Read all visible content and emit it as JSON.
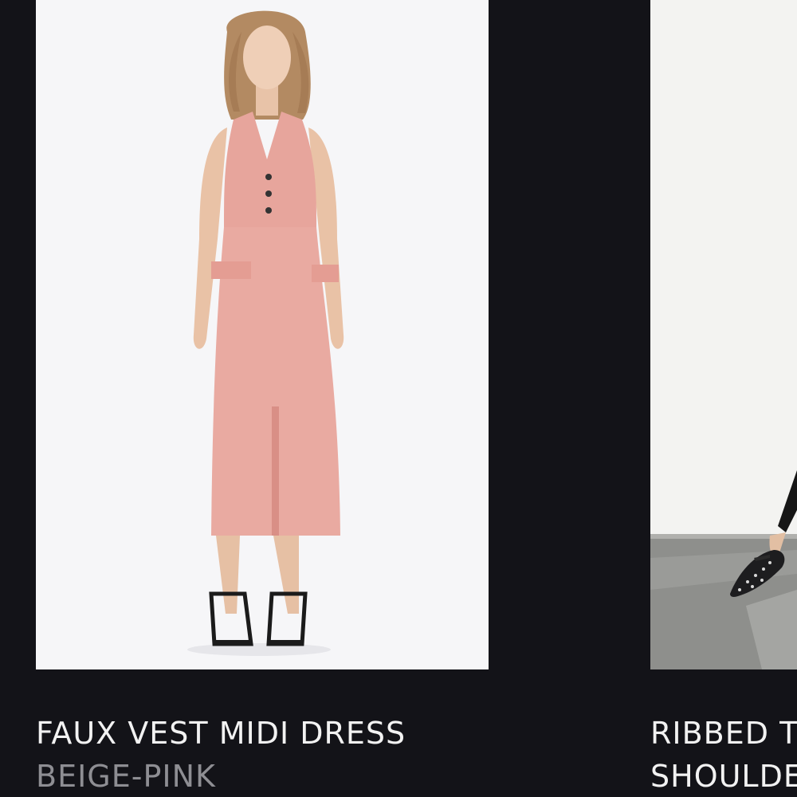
{
  "products": [
    {
      "name": "FAUX VEST MIDI DRESS",
      "color": "BEIGE-PINK",
      "image_alt": "product-photo-pink-vest-dress"
    },
    {
      "name": "RIBBED T",
      "color": "SHOULDE",
      "image_alt": "product-photo-studded-flats"
    }
  ],
  "colors": {
    "background": "#131318",
    "title_text": "#f2f2f2",
    "subtitle_text": "#8e8e93",
    "dress": "#e9a9a1"
  }
}
